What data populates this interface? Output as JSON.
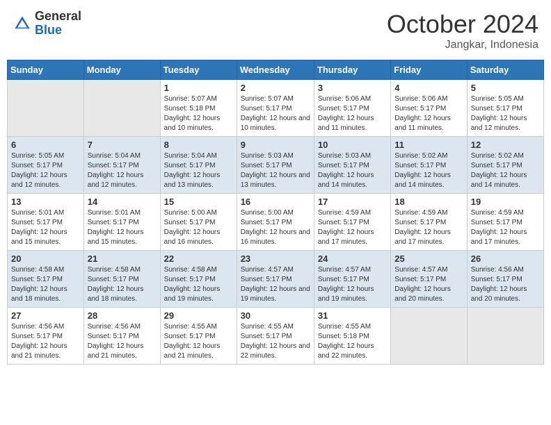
{
  "header": {
    "logo_general": "General",
    "logo_blue": "Blue",
    "month": "October 2024",
    "location": "Jangkar, Indonesia"
  },
  "calendar": {
    "days_of_week": [
      "Sunday",
      "Monday",
      "Tuesday",
      "Wednesday",
      "Thursday",
      "Friday",
      "Saturday"
    ],
    "weeks": [
      [
        {
          "day": "",
          "info": ""
        },
        {
          "day": "",
          "info": ""
        },
        {
          "day": "1",
          "info": "Sunrise: 5:07 AM\nSunset: 5:18 PM\nDaylight: 12 hours and 10 minutes."
        },
        {
          "day": "2",
          "info": "Sunrise: 5:07 AM\nSunset: 5:17 PM\nDaylight: 12 hours and 10 minutes."
        },
        {
          "day": "3",
          "info": "Sunrise: 5:06 AM\nSunset: 5:17 PM\nDaylight: 12 hours and 11 minutes."
        },
        {
          "day": "4",
          "info": "Sunrise: 5:06 AM\nSunset: 5:17 PM\nDaylight: 12 hours and 11 minutes."
        },
        {
          "day": "5",
          "info": "Sunrise: 5:05 AM\nSunset: 5:17 PM\nDaylight: 12 hours and 12 minutes."
        }
      ],
      [
        {
          "day": "6",
          "info": "Sunrise: 5:05 AM\nSunset: 5:17 PM\nDaylight: 12 hours and 12 minutes."
        },
        {
          "day": "7",
          "info": "Sunrise: 5:04 AM\nSunset: 5:17 PM\nDaylight: 12 hours and 12 minutes."
        },
        {
          "day": "8",
          "info": "Sunrise: 5:04 AM\nSunset: 5:17 PM\nDaylight: 12 hours and 13 minutes."
        },
        {
          "day": "9",
          "info": "Sunrise: 5:03 AM\nSunset: 5:17 PM\nDaylight: 12 hours and 13 minutes."
        },
        {
          "day": "10",
          "info": "Sunrise: 5:03 AM\nSunset: 5:17 PM\nDaylight: 12 hours and 14 minutes."
        },
        {
          "day": "11",
          "info": "Sunrise: 5:02 AM\nSunset: 5:17 PM\nDaylight: 12 hours and 14 minutes."
        },
        {
          "day": "12",
          "info": "Sunrise: 5:02 AM\nSunset: 5:17 PM\nDaylight: 12 hours and 14 minutes."
        }
      ],
      [
        {
          "day": "13",
          "info": "Sunrise: 5:01 AM\nSunset: 5:17 PM\nDaylight: 12 hours and 15 minutes."
        },
        {
          "day": "14",
          "info": "Sunrise: 5:01 AM\nSunset: 5:17 PM\nDaylight: 12 hours and 15 minutes."
        },
        {
          "day": "15",
          "info": "Sunrise: 5:00 AM\nSunset: 5:17 PM\nDaylight: 12 hours and 16 minutes."
        },
        {
          "day": "16",
          "info": "Sunrise: 5:00 AM\nSunset: 5:17 PM\nDaylight: 12 hours and 16 minutes."
        },
        {
          "day": "17",
          "info": "Sunrise: 4:59 AM\nSunset: 5:17 PM\nDaylight: 12 hours and 17 minutes."
        },
        {
          "day": "18",
          "info": "Sunrise: 4:59 AM\nSunset: 5:17 PM\nDaylight: 12 hours and 17 minutes."
        },
        {
          "day": "19",
          "info": "Sunrise: 4:59 AM\nSunset: 5:17 PM\nDaylight: 12 hours and 17 minutes."
        }
      ],
      [
        {
          "day": "20",
          "info": "Sunrise: 4:58 AM\nSunset: 5:17 PM\nDaylight: 12 hours and 18 minutes."
        },
        {
          "day": "21",
          "info": "Sunrise: 4:58 AM\nSunset: 5:17 PM\nDaylight: 12 hours and 18 minutes."
        },
        {
          "day": "22",
          "info": "Sunrise: 4:58 AM\nSunset: 5:17 PM\nDaylight: 12 hours and 19 minutes."
        },
        {
          "day": "23",
          "info": "Sunrise: 4:57 AM\nSunset: 5:17 PM\nDaylight: 12 hours and 19 minutes."
        },
        {
          "day": "24",
          "info": "Sunrise: 4:57 AM\nSunset: 5:17 PM\nDaylight: 12 hours and 19 minutes."
        },
        {
          "day": "25",
          "info": "Sunrise: 4:57 AM\nSunset: 5:17 PM\nDaylight: 12 hours and 20 minutes."
        },
        {
          "day": "26",
          "info": "Sunrise: 4:56 AM\nSunset: 5:17 PM\nDaylight: 12 hours and 20 minutes."
        }
      ],
      [
        {
          "day": "27",
          "info": "Sunrise: 4:56 AM\nSunset: 5:17 PM\nDaylight: 12 hours and 21 minutes."
        },
        {
          "day": "28",
          "info": "Sunrise: 4:56 AM\nSunset: 5:17 PM\nDaylight: 12 hours and 21 minutes."
        },
        {
          "day": "29",
          "info": "Sunrise: 4:55 AM\nSunset: 5:17 PM\nDaylight: 12 hours and 21 minutes."
        },
        {
          "day": "30",
          "info": "Sunrise: 4:55 AM\nSunset: 5:17 PM\nDaylight: 12 hours and 22 minutes."
        },
        {
          "day": "31",
          "info": "Sunrise: 4:55 AM\nSunset: 5:18 PM\nDaylight: 12 hours and 22 minutes."
        },
        {
          "day": "",
          "info": ""
        },
        {
          "day": "",
          "info": ""
        }
      ]
    ]
  }
}
